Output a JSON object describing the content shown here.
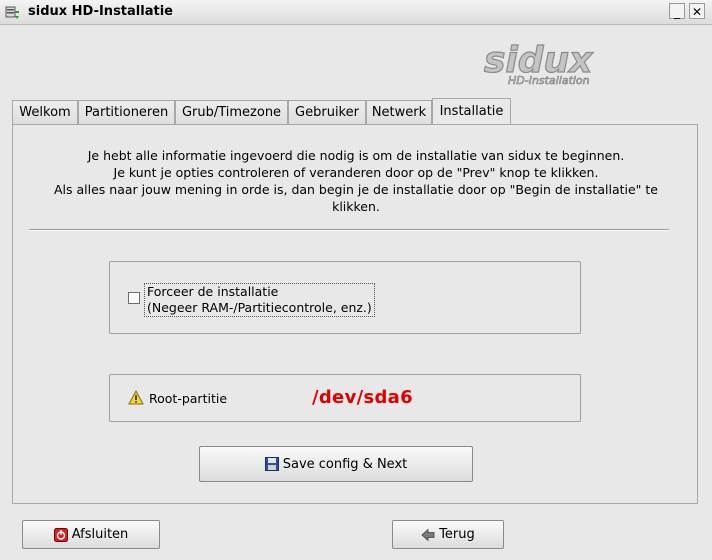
{
  "window": {
    "title": "sidux HD-Installatie",
    "minimize_glyph": "_",
    "close_glyph": "✕"
  },
  "logo": {
    "brand": "sidux",
    "tagline": "HD-Installation"
  },
  "tabs": [
    {
      "label": "Welkom"
    },
    {
      "label": "Partitioneren"
    },
    {
      "label": "Grub/Timezone"
    },
    {
      "label": "Gebruiker"
    },
    {
      "label": "Netwerk"
    },
    {
      "label": "Installatie",
      "active": true
    }
  ],
  "intro": {
    "lines": [
      "Je hebt alle informatie ingevoerd die nodig is om de installatie van sidux te beginnen.",
      "Je kunt je opties controleren of veranderen door op de \"Prev\" knop te klikken.",
      "Als alles naar jouw mening  in orde is, dan begin je de installatie door op \"Begin de installatie\" te",
      "klikken."
    ]
  },
  "force_install": {
    "checked": false,
    "label_line1": "Forceer de installatie",
    "label_line2": "(Negeer RAM-/Partitiecontrole, enz.)"
  },
  "root_partition": {
    "label": "Root-partitie",
    "value": "/dev/sda6",
    "value_color": "#e00000"
  },
  "buttons": {
    "save_next": "Save config & Next",
    "quit": "Afsluiten",
    "back": "Terug"
  },
  "icons": {
    "app": "install-icon",
    "warning": "warning-icon",
    "save": "floppy-disk-icon",
    "quit": "power-icon",
    "back": "arrow-left-icon"
  }
}
